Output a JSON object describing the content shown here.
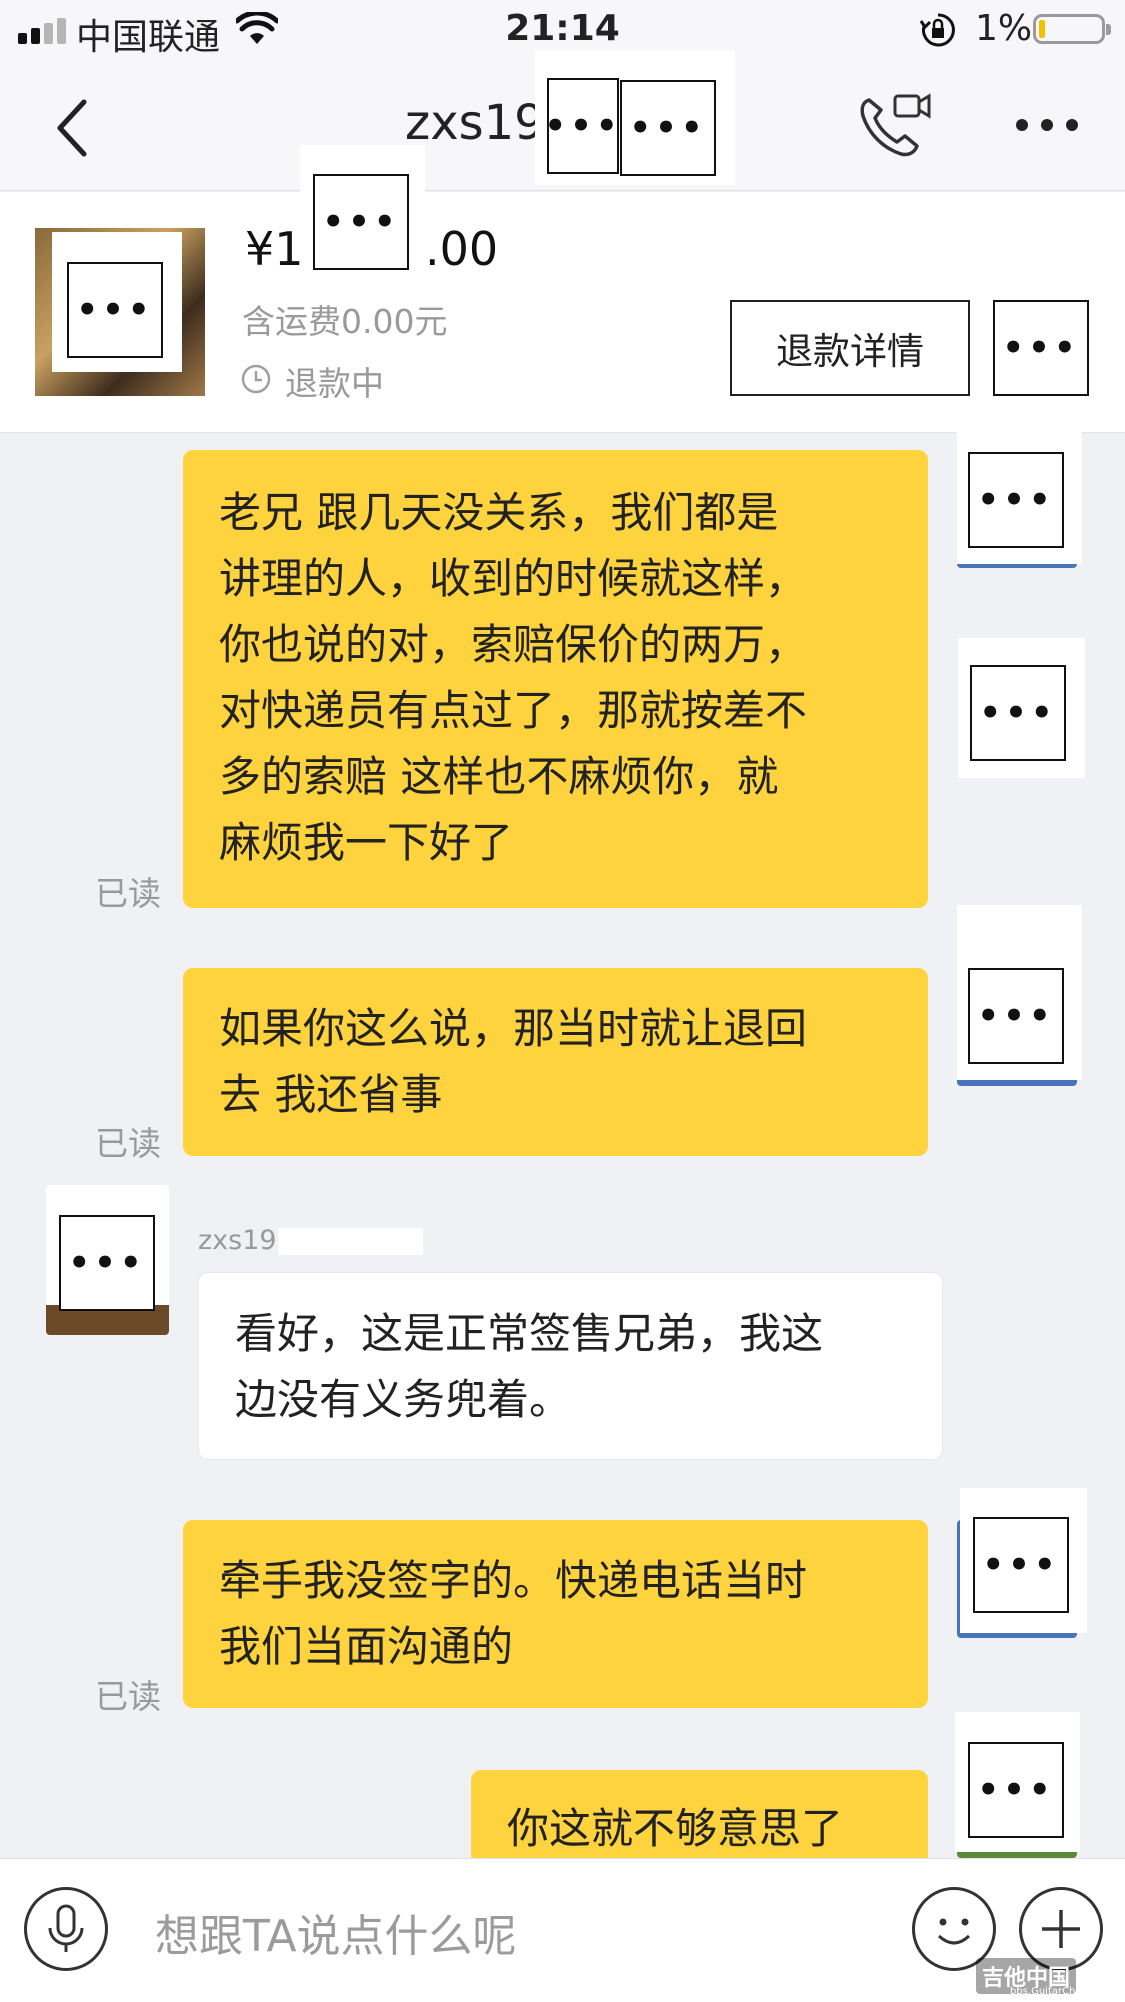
{
  "status_bar": {
    "carrier": "中国联通",
    "time": "21:14",
    "battery_percent": "1%",
    "battery_level": 0.01,
    "signal_bars_active": 3
  },
  "nav": {
    "title": "zxs19",
    "redacted_mark": "•••"
  },
  "order": {
    "price_prefix": "¥1",
    "price_suffix": ".00",
    "shipping": "含运费0.00元",
    "status": "退款中",
    "refund_detail_button": "退款详情",
    "redacted_mark": "•••"
  },
  "messages": [
    {
      "direction": "out",
      "read_label": "已读",
      "lines": [
        "老兄 跟几天没关系，我们都是",
        "讲理的人，收到的时候就这样，",
        "你也说的对，索赔保价的两万，",
        "对快递员有点过了，那就按差不",
        "多的索赔 这样也不麻烦你，就",
        "麻烦我一下好了"
      ]
    },
    {
      "direction": "out",
      "read_label": "已读",
      "lines": [
        "如果你这么说，那当时就让退回",
        "去 我还省事"
      ]
    },
    {
      "direction": "in",
      "sender": "zxs19",
      "lines": [
        "看好，这是正常签售兄弟，我这",
        "边没有义务兜着。"
      ]
    },
    {
      "direction": "out",
      "read_label": "已读",
      "lines": [
        "牵手我没签字的。快递电话当时",
        "我们当面沟通的"
      ]
    },
    {
      "direction": "out",
      "lines": [
        "你这就不够意思了"
      ]
    }
  ],
  "input": {
    "placeholder": "想跟TA说点什么呢"
  },
  "watermark": {
    "text": "吉他中国",
    "sub": "bbs.GuitarChina.com"
  },
  "colors": {
    "bubble_out": "#fed33d",
    "bubble_in": "#ffffff",
    "background": "#f0f1f5"
  }
}
